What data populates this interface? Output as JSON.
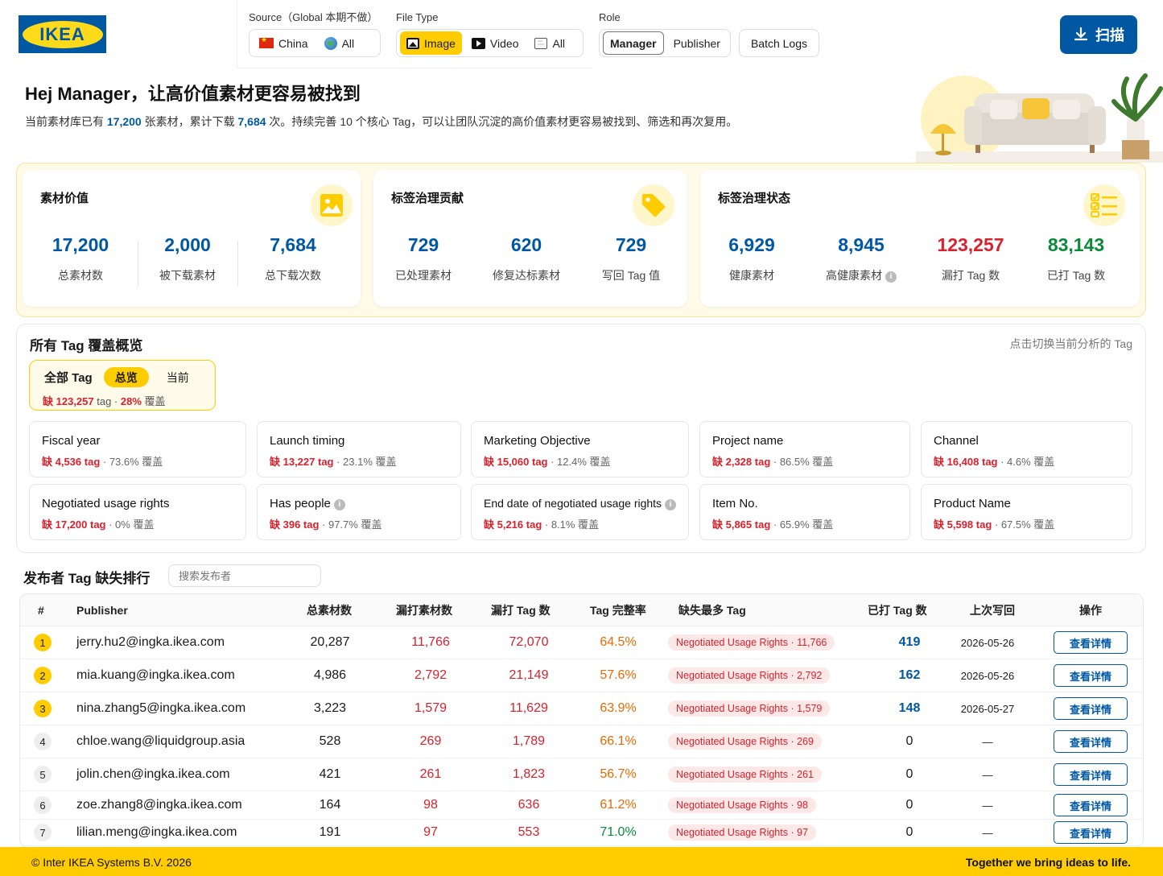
{
  "brand": {
    "logo_text": "IKEA",
    "colors": {
      "blue": "#0058a3",
      "yellow": "#ffcc00",
      "red": "#d8212c",
      "orange": "#e86a00",
      "green": "#0a8a3a"
    }
  },
  "filters": {
    "source_label": "Source（Global 本期不做）",
    "source_options": [
      "China",
      "All"
    ],
    "filetype_label": "File Type",
    "filetype_options": [
      "Image",
      "Video",
      "All"
    ],
    "filetype_selected": "Image",
    "role_label": "Role",
    "role_options": [
      "Manager",
      "Publisher"
    ],
    "role_selected": "Manager",
    "batch_logs": "Batch Logs"
  },
  "scan_button": "扫描",
  "hero": {
    "title": "Hej Manager，让高价值素材更容易被找到",
    "desc_p1": "当前素材库已有 ",
    "desc_n1": "17,200",
    "desc_p2": " 张素材，累计下载 ",
    "desc_n2": "7,684",
    "desc_p3": " 次。持续完善 10 个核心 Tag，可以让团队沉淀的高价值素材更容易被找到、筛选和再次复用。"
  },
  "stats": {
    "value": {
      "title": "素材价值",
      "items": [
        {
          "value": "17,200",
          "label": "总素材数"
        },
        {
          "value": "2,000",
          "label": "被下载素材"
        },
        {
          "value": "7,684",
          "label": "总下载次数"
        }
      ]
    },
    "contribution": {
      "title": "标签治理贡献",
      "items": [
        {
          "value": "729",
          "label": "已处理素材"
        },
        {
          "value": "620",
          "label": "修复达标素材"
        },
        {
          "value": "729",
          "label": "写回 Tag 值"
        }
      ]
    },
    "status": {
      "title": "标签治理状态",
      "items": [
        {
          "value": "6,929",
          "label": "健康素材"
        },
        {
          "value": "8,945",
          "label": "高健康素材"
        },
        {
          "value": "123,257",
          "label": "漏打 Tag 数"
        },
        {
          "value": "83,143",
          "label": "已打 Tag 数"
        }
      ]
    }
  },
  "tag_overview": {
    "title": "所有 Tag 覆盖概览",
    "hint": "点击切换当前分析的 Tag",
    "all_tag": {
      "title": "全部 Tag",
      "tabs": [
        "总览",
        "当前"
      ],
      "missing_prefix": "缺 ",
      "missing": "123,257",
      "missing_unit": " tag",
      "dot": " · ",
      "coverage": "28%",
      "coverage_suffix": " 覆盖"
    },
    "cards": [
      {
        "name": "Fiscal year",
        "missing": "缺 4,536 tag",
        "coverage": " · 73.6% 覆盖"
      },
      {
        "name": "Launch timing",
        "missing": "缺 13,227 tag",
        "coverage": " · 23.1% 覆盖"
      },
      {
        "name": "Marketing Objective",
        "missing": "缺 15,060 tag",
        "coverage": " · 12.4% 覆盖"
      },
      {
        "name": "Project name",
        "missing": "缺 2,328 tag",
        "coverage": " · 86.5% 覆盖"
      },
      {
        "name": "Channel",
        "missing": "缺 16,408 tag",
        "coverage": " · 4.6% 覆盖"
      },
      {
        "name": "Negotiated usage rights",
        "missing": "缺 17,200 tag",
        "coverage": " · 0% 覆盖"
      },
      {
        "name": "Has people",
        "missing": "缺 396 tag",
        "coverage": " · 97.7% 覆盖"
      },
      {
        "name": "End date of negotiated usage rights",
        "missing": "缺 5,216 tag",
        "coverage": " · 8.1% 覆盖"
      },
      {
        "name": "Item No.",
        "missing": "缺 5,865 tag",
        "coverage": " · 65.9% 覆盖"
      },
      {
        "name": "Product Name",
        "missing": "缺 5,598 tag",
        "coverage": " · 67.5% 覆盖"
      }
    ]
  },
  "ranking": {
    "title": "发布者 Tag 缺失排行",
    "search_placeholder": "搜索发布者",
    "columns": [
      "#",
      "Publisher",
      "总素材数",
      "漏打素材数",
      "漏打 Tag 数",
      "Tag 完整率",
      "缺失最多 Tag",
      "已打 Tag 数",
      "上次写回",
      "操作"
    ],
    "rows": [
      {
        "rank": "1",
        "publisher": "jerry.hu2@ingka.ikea.com",
        "total": "20,287",
        "missing_assets": "11,766",
        "missing_tags": "72,070",
        "rate": "64.5%",
        "top_missing": "Negotiated Usage Rights · 11,766",
        "tagged": "419",
        "last": "2026-05-26",
        "action": "查看详情"
      },
      {
        "rank": "2",
        "publisher": "mia.kuang@ingka.ikea.com",
        "total": "4,986",
        "missing_assets": "2,792",
        "missing_tags": "21,149",
        "rate": "57.6%",
        "top_missing": "Negotiated Usage Rights · 2,792",
        "tagged": "162",
        "last": "2026-05-26",
        "action": "查看详情"
      },
      {
        "rank": "3",
        "publisher": "nina.zhang5@ingka.ikea.com",
        "total": "3,223",
        "missing_assets": "1,579",
        "missing_tags": "11,629",
        "rate": "63.9%",
        "top_missing": "Negotiated Usage Rights · 1,579",
        "tagged": "148",
        "last": "2026-05-27",
        "action": "查看详情"
      },
      {
        "rank": "4",
        "publisher": "chloe.wang@liquidgroup.asia",
        "total": "528",
        "missing_assets": "269",
        "missing_tags": "1,789",
        "rate": "66.1%",
        "top_missing": "Negotiated Usage Rights · 269",
        "tagged": "0",
        "last": "—",
        "action": "查看详情"
      },
      {
        "rank": "5",
        "publisher": "jolin.chen@ingka.ikea.com",
        "total": "421",
        "missing_assets": "261",
        "missing_tags": "1,823",
        "rate": "56.7%",
        "top_missing": "Negotiated Usage Rights · 261",
        "tagged": "0",
        "last": "—",
        "action": "查看详情"
      },
      {
        "rank": "6",
        "publisher": "zoe.zhang8@ingka.ikea.com",
        "total": "164",
        "missing_assets": "98",
        "missing_tags": "636",
        "rate": "61.2%",
        "top_missing": "Negotiated Usage Rights · 98",
        "tagged": "0",
        "last": "—",
        "action": "查看详情"
      },
      {
        "rank": "7",
        "publisher": "lilian.meng@ingka.ikea.com",
        "total": "191",
        "missing_assets": "97",
        "missing_tags": "553",
        "rate": "71.0%",
        "top_missing": "Negotiated Usage Rights · 97",
        "tagged": "0",
        "last": "—",
        "action": "查看详情"
      }
    ]
  },
  "footer": {
    "left": "© Inter IKEA Systems B.V. 2026",
    "right": "Together we bring ideas to life."
  }
}
